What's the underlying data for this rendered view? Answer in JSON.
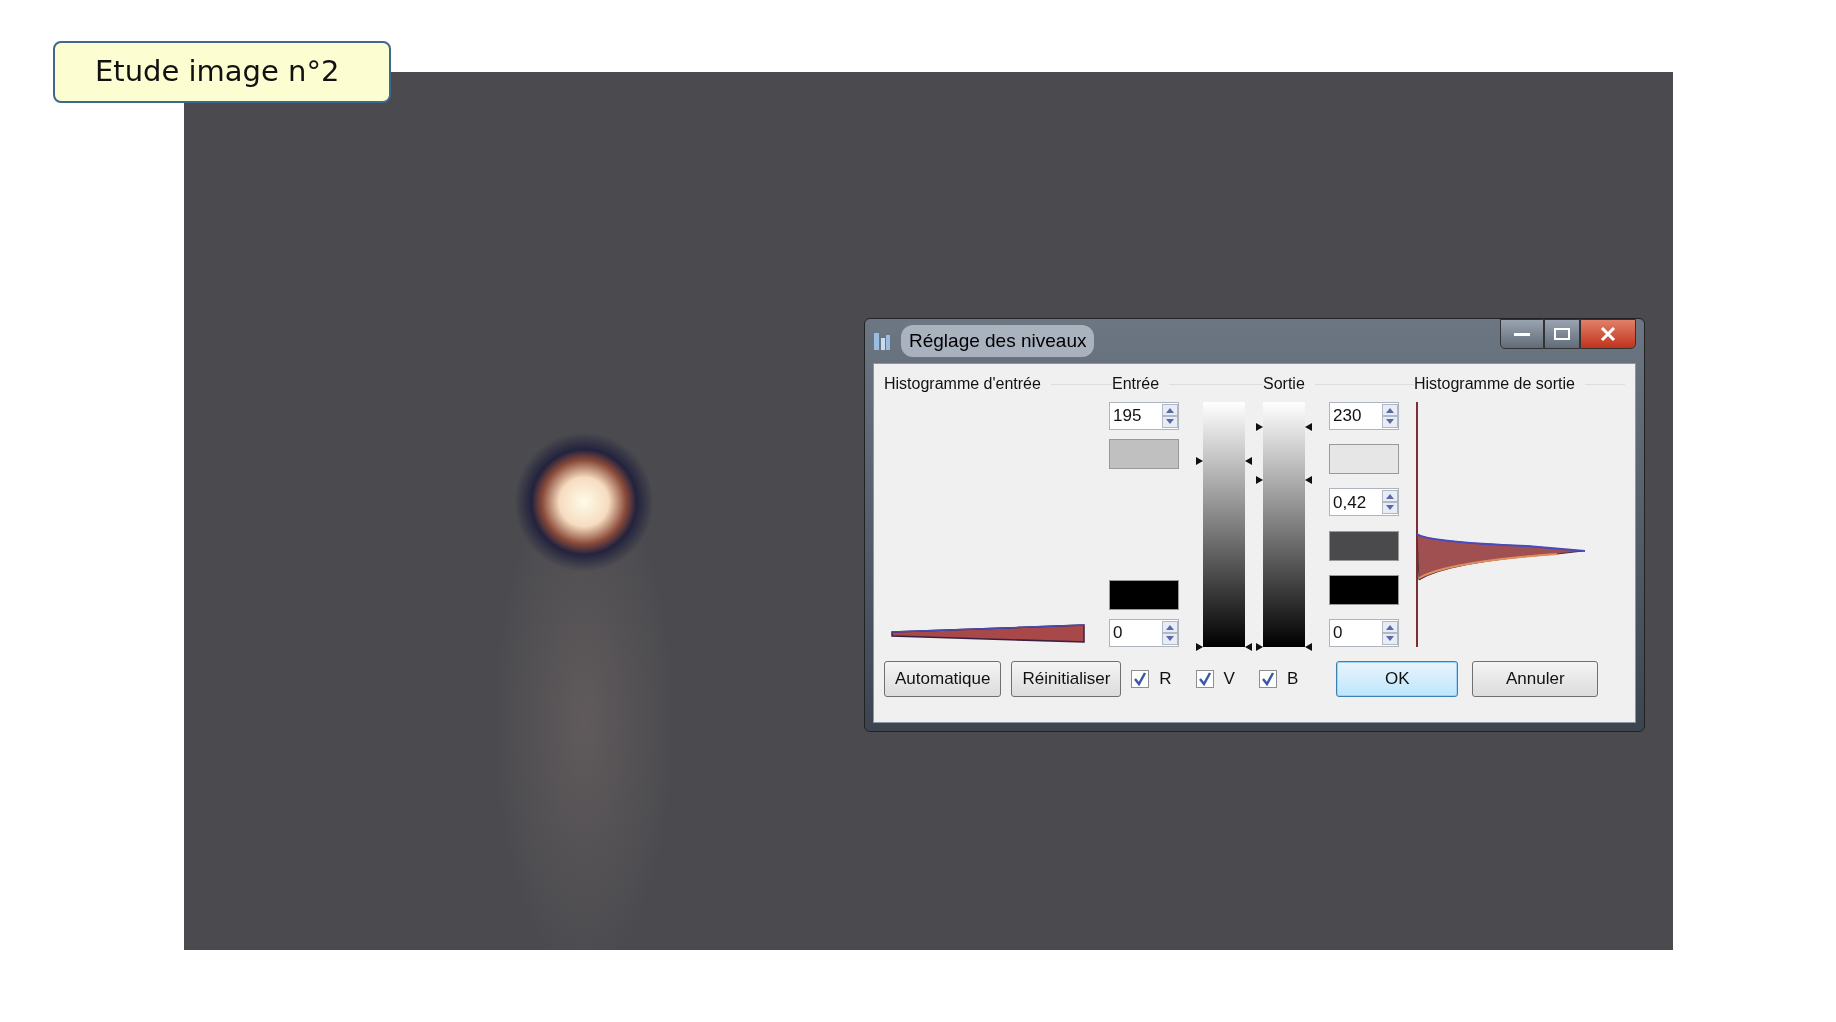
{
  "slide": {
    "title": "Etude image n°2"
  },
  "dialog": {
    "title": "Réglage des niveaux",
    "headers": [
      "Histogramme d'entrée",
      "Entrée",
      "Sortie",
      "Histogramme de sortie"
    ],
    "input_fields": {
      "top": [
        {
          "kind": "spin",
          "value": "195"
        },
        {
          "kind": "swatch",
          "color": "#c0c0c0"
        }
      ],
      "bottom": [
        {
          "kind": "swatch",
          "color": "#000000"
        },
        {
          "kind": "spin",
          "value": "0"
        }
      ]
    },
    "input_slider": {
      "thumbs": [
        {
          "level": 0.76
        },
        {
          "level": 0
        }
      ]
    },
    "output_slider": {
      "thumbs": [
        {
          "level": 0.9
        },
        {
          "level": 0.68
        },
        {
          "level": 0
        }
      ]
    },
    "output_fields": [
      {
        "kind": "spin",
        "value": "230"
      },
      {
        "kind": "swatch",
        "color": "#e6e6e6"
      },
      {
        "kind": "spin",
        "value": "0,42"
      },
      {
        "kind": "swatch",
        "color": "#4a4a4c"
      },
      {
        "kind": "swatch",
        "color": "#000000"
      },
      {
        "kind": "spin",
        "value": "0"
      }
    ],
    "buttons_left": [
      {
        "label": "Automatique",
        "default": false
      },
      {
        "label": "Réinitialiser",
        "default": false
      }
    ],
    "channels": [
      {
        "label": "R",
        "checked": true
      },
      {
        "label": "V",
        "checked": true
      },
      {
        "label": "B",
        "checked": true
      }
    ],
    "buttons_right": [
      {
        "label": "OK",
        "default": true
      },
      {
        "label": "Annuler",
        "default": false
      }
    ]
  }
}
